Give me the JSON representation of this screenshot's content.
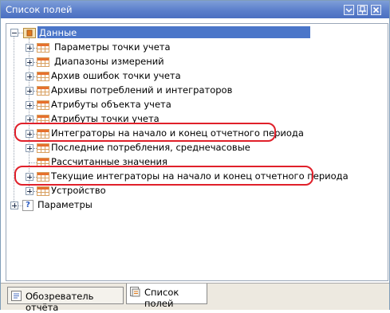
{
  "window": {
    "title": "Список полей",
    "buttons": [
      "dropdown",
      "pin",
      "close"
    ]
  },
  "tree": {
    "root": {
      "label": "Данные",
      "expanded": true,
      "selected": true
    },
    "children": [
      {
        "label": "Параметры точки учета",
        "highlighted": false
      },
      {
        "label": "Диапазоны измерений",
        "highlighted": false
      },
      {
        "label": "Архив ошибок точки учета",
        "highlighted": false
      },
      {
        "label": "Архивы потреблений и интеграторов",
        "highlighted": false
      },
      {
        "label": "Атрибуты объекта учета",
        "highlighted": false
      },
      {
        "label": "Атрибуты точки учета",
        "highlighted": false
      },
      {
        "label": "Интеграторы на начало и конец отчетного периода",
        "highlighted": true
      },
      {
        "label": "Последние потребления, среднечасовые",
        "highlighted": false
      },
      {
        "label": "Рассчитанные значения",
        "highlighted": false
      },
      {
        "label": "Текущие интеграторы на начало и конец отчетного периода",
        "highlighted": true
      },
      {
        "label": "Устройство",
        "highlighted": false
      }
    ],
    "second_root": {
      "label": "Параметры",
      "expanded": false
    }
  },
  "tabs": [
    {
      "label": "Обозреватель отчёта",
      "active": false
    },
    {
      "label": "Список полей",
      "active": true
    }
  ],
  "colors": {
    "titlebar": "#5b7fcb",
    "selection": "#4b76c9",
    "highlight_ring": "#e0202a"
  }
}
